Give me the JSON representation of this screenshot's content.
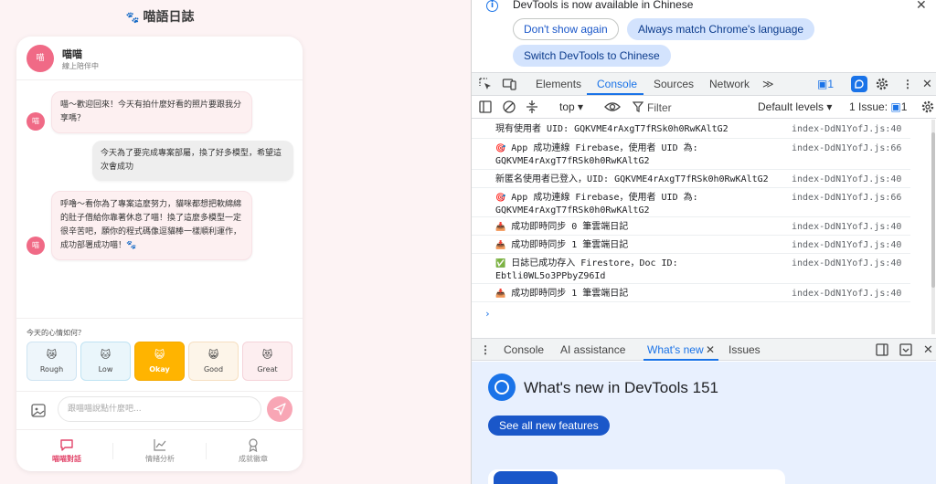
{
  "app": {
    "title": "喵語日誌",
    "paw": "🐾",
    "header": {
      "avatar": "喵",
      "name": "喵喵",
      "status": "線上陪伴中"
    },
    "messages": [
      {
        "sender": "cat",
        "avatar": "喵",
        "text": "喵～歡迎回來！今天有拍什麼好看的照片要跟我分享嗎？"
      },
      {
        "sender": "user",
        "text": "今天為了要完成專案部屬，換了好多模型，希望這次會成功"
      },
      {
        "sender": "cat",
        "avatar": "喵",
        "text": "呼嚕～看你為了專案這麼努力，貓咪都想把軟綿綿的肚子借給你靠著休息了喵！換了這麼多模型一定很辛苦吧，願你的程式碼像逗貓棒一樣順利運作，成功部署成功喵！🐾"
      }
    ],
    "mood": {
      "prompt": "今天的心情如何？",
      "options": [
        {
          "emoji": "😿",
          "label": "Rough"
        },
        {
          "emoji": "🐱",
          "label": "Low"
        },
        {
          "emoji": "😺",
          "label": "Okay"
        },
        {
          "emoji": "😸",
          "label": "Good"
        },
        {
          "emoji": "😻",
          "label": "Great"
        }
      ],
      "selected": "Okay"
    },
    "input": {
      "placeholder": "跟喵喵說點什麼吧..."
    },
    "nav": [
      {
        "label": "喵喵對話",
        "icon": "chat-icon"
      },
      {
        "label": "情緒分析",
        "icon": "chart-icon"
      },
      {
        "label": "成就徽章",
        "icon": "badge-icon"
      }
    ],
    "colors": {
      "accent": "#e2456a",
      "avatar": "#f06a86",
      "selected_mood": "#ffb400"
    }
  },
  "devtools": {
    "infobar": {
      "text": "DevTools is now available in Chinese",
      "dont_show": "Don't show again",
      "always_match": "Always match Chrome's language",
      "switch": "Switch DevTools to Chinese"
    },
    "tabs": [
      "Elements",
      "Console",
      "Sources",
      "Network"
    ],
    "active_tab": "Console",
    "more_tabs": "≫",
    "message_badge": "1",
    "toolbar": {
      "context": "top ▾",
      "filter_placeholder": "Filter",
      "levels": "Default levels ▾",
      "issues_label": "1 Issue:",
      "issues_count": "1"
    },
    "logs": [
      {
        "emoji": "",
        "message": "現有使用者 UID: GQKVME4rAxgT7fRSk0h0RwKAltG2",
        "source": "index-DdN1YofJ.js:40"
      },
      {
        "emoji": "🎯",
        "message": "App 成功連線 Firebase，使用者 UID 為:\nGQKVME4rAxgT7fRSk0h0RwKAltG2",
        "source": "index-DdN1YofJ.js:66"
      },
      {
        "emoji": "",
        "message": "新匿名使用者已登入，UID: GQKVME4rAxgT7fRSk0h0RwKAltG2",
        "source": "index-DdN1YofJ.js:40"
      },
      {
        "emoji": "🎯",
        "message": "App 成功連線 Firebase，使用者 UID 為:\nGQKVME4rAxgT7fRSk0h0RwKAltG2",
        "source": "index-DdN1YofJ.js:66"
      },
      {
        "emoji": "📥",
        "message": "成功即時同步 0 筆雲端日記",
        "source": "index-DdN1YofJ.js:40"
      },
      {
        "emoji": "📥",
        "message": "成功即時同步 1 筆雲端日記",
        "source": "index-DdN1YofJ.js:40"
      },
      {
        "emoji": "✅",
        "message": "日誌已成功存入 Firestore，Doc ID:\nEbtli0WL5o3PPbyZ96Id",
        "source": "index-DdN1YofJ.js:40"
      },
      {
        "emoji": "📥",
        "message": "成功即時同步 1 筆雲端日記",
        "source": "index-DdN1YofJ.js:40"
      }
    ],
    "prompt": "›",
    "drawer_tabs": [
      "Console",
      "AI assistance",
      "What's new",
      "Issues"
    ],
    "active_drawer_tab": "What's new",
    "whats_new": {
      "title": "What's new in DevTools 151",
      "button": "See all new features"
    }
  }
}
